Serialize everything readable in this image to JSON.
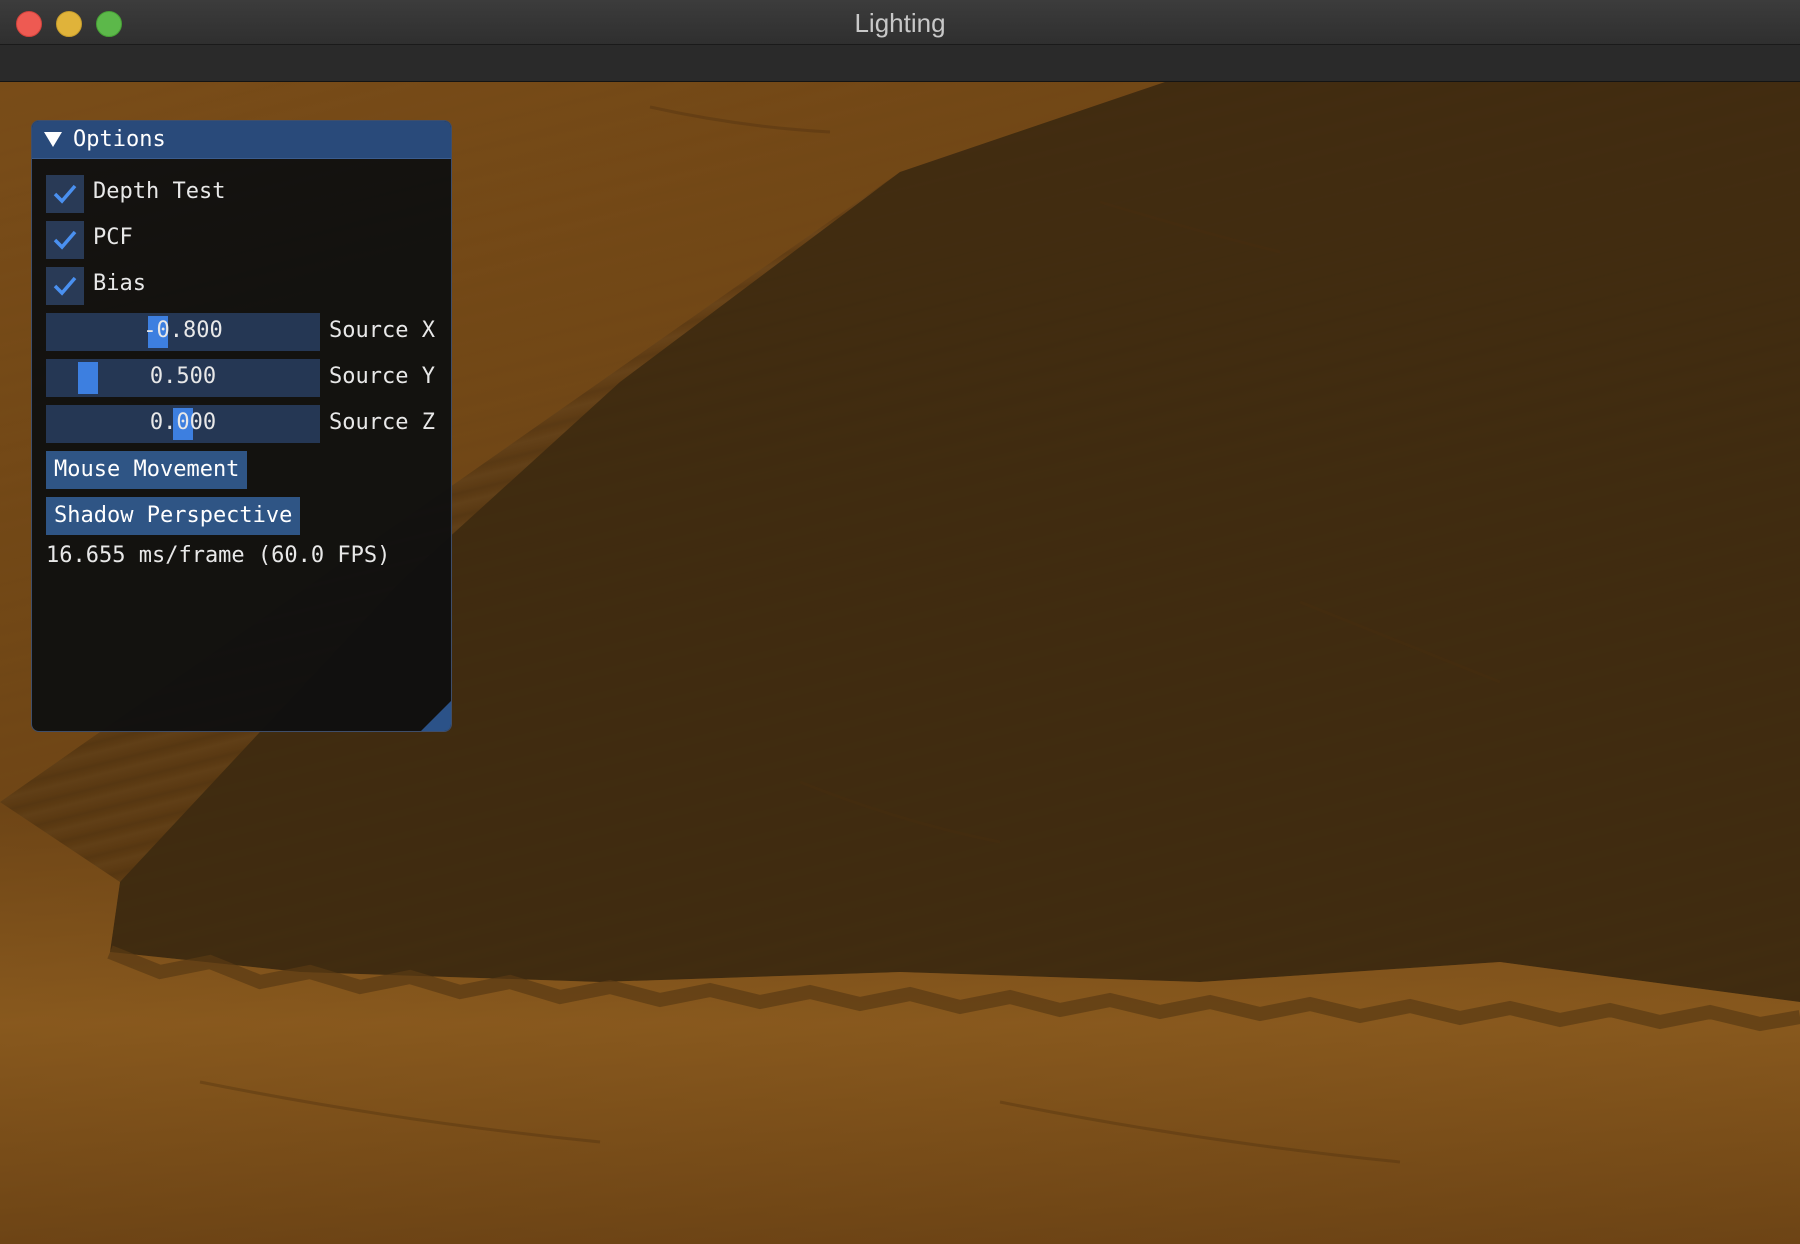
{
  "window": {
    "title": "Lighting"
  },
  "options_panel": {
    "title": "Options",
    "checkboxes": [
      {
        "label": "Depth Test",
        "checked": true
      },
      {
        "label": "PCF",
        "checked": true
      },
      {
        "label": "Bias",
        "checked": true
      }
    ],
    "sliders": [
      {
        "label": "Source X",
        "value": "-0.800",
        "fraction": 0.4
      },
      {
        "label": "Source Y",
        "value": "0.500",
        "fraction": 0.125
      },
      {
        "label": "Source Z",
        "value": "0.000",
        "fraction": 0.5
      }
    ],
    "buttons": [
      {
        "label": "Mouse Movement"
      },
      {
        "label": "Shadow Perspective"
      }
    ],
    "fps_text": "16.655 ms/frame (60.0 FPS)"
  },
  "colors": {
    "panel_header": "#294a7a",
    "frame_bg": "#253754",
    "accent": "#3d7fe0",
    "button": "#2f5585",
    "floor_lit": "#8a5a1e",
    "floor_shadow": "#3e2a10"
  },
  "icons": {
    "close": "traffic-light-red",
    "minimize": "traffic-light-yellow",
    "maximize": "traffic-light-green",
    "collapse": "triangle-down",
    "check": "checkmark"
  }
}
